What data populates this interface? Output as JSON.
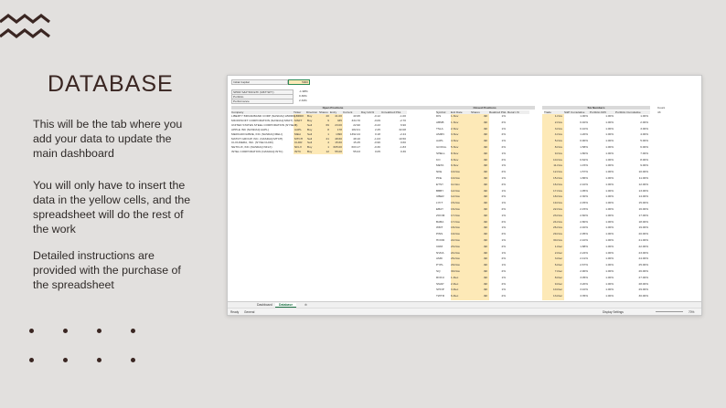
{
  "colors": {
    "background": "#e2e0de",
    "accent": "#3a2622",
    "input_cells": "#fde9b7"
  },
  "icons": {
    "zigzag": "zigzag-decoration-icon",
    "dots": "dot-grid-decoration-icon"
  },
  "heading": "DATABASE",
  "paragraphs": [
    "This will be the tab where you add your data to update the main dashboard",
    "You will only have to insert the data in the yellow cells, and the spreadsheet will do the rest of the work",
    "Detailed instructions are provided with the purchase of the spreadsheet"
  ],
  "sheet": {
    "initial_capital_label": "Initial Capital",
    "initial_capital_value": "5000",
    "benchmark_label": "SPDR S&P 500 ETF (MKT:SPY)",
    "benchmark_value": "-1.98%",
    "portfolio_label": "Portfolio",
    "portfolio_value": "0.36%",
    "performance_label": "Performance",
    "performance_value": "2.34%",
    "open_positions_header": "Open Positions",
    "open_columns": [
      "Company",
      "Ticker",
      "Direction",
      "Shares",
      "Entry",
      "Current",
      "Day G/L%",
      "Unrealized P&L"
    ],
    "open_rows": [
      [
        "LIBERTY BROADBAND CORP (NASDAQ:LBRDK)",
        "LBRDK",
        "Buy",
        "20",
        "41.00",
        "40.95",
        "-0.12",
        "-1.00"
      ],
      [
        "MICROSOFT CORPORATION (NASDAQ:MSFT)",
        "MSFT",
        "Buy",
        "9",
        "335",
        "334.70",
        "-0.09",
        "-2.70"
      ],
      [
        "UNITED STATES STEEL CORPORATION (NYSE:X)",
        "X",
        "Sell",
        "69",
        "23.00",
        "22.90",
        "-0.43",
        "6.90"
      ],
      [
        "APPLE INC (NASDAQ:AAPL)",
        "AAPL",
        "Buy",
        "8",
        "178",
        "182.01",
        "2.25",
        "32.08"
      ],
      [
        "MERCADOLIBRE, INC (NASDAQ:MELI)",
        "MELI",
        "Sell",
        "1",
        "1390",
        "1392.44",
        "0.18",
        "-2.44"
      ],
      [
        "MATCH GROUP, INC. (NASDAQ:MTCH)",
        "MTCH",
        "Sell",
        "21",
        "48.60",
        "48.10",
        "-1.03",
        "10.50"
      ],
      [
        "CLOUDERA, INC. (NYSE:CLDR)",
        "CLDR",
        "Sell",
        "4",
        "15.60",
        "15.45",
        "-0.96",
        "0.60"
      ],
      [
        "NETFLIX, INC (NASDAQ:NFLX)",
        "NFLX",
        "Buy",
        "1",
        "605.00",
        "603.17",
        "-0.30",
        "-1.83"
      ],
      [
        "INTEL CORPORATION (NASDAQ:INTC)",
        "INTC",
        "Buy",
        "12",
        "55.00",
        "55.03",
        "0.05",
        "0.36"
      ]
    ],
    "closed_positions_header": "Closed Positions",
    "closed_columns": [
      "Symbol",
      "Exit Date",
      "Shares",
      "Realized P&L",
      "Return %"
    ],
    "closed_rows": [
      [
        "DIS",
        "1-Nov",
        "-$0",
        "1%"
      ],
      [
        "ABNB",
        "1-Nov",
        "-$0",
        "2%"
      ],
      [
        "TSLA",
        "2-Nov",
        "-$0",
        "1%"
      ],
      [
        "AMZN",
        "3-Nov",
        "-$0",
        "2%"
      ],
      [
        "AAPL",
        "4-Nov",
        "-$0",
        "1%"
      ],
      [
        "GOOGL",
        "5-Nov",
        "-$0",
        "2%"
      ],
      [
        "SHELL",
        "8-Nov",
        "-$0",
        "1%"
      ],
      [
        "KO",
        "9-Nov",
        "-$0",
        "2%"
      ],
      [
        "META",
        "9-Nov",
        "-$0",
        "1%"
      ],
      [
        "NKE",
        "10-Nov",
        "-$0",
        "2%"
      ],
      [
        "PFE",
        "10-Nov",
        "-$0",
        "1%"
      ],
      [
        "ETSY",
        "11-Nov",
        "-$0",
        "2%"
      ],
      [
        "BBBY",
        "12-Nov",
        "-$0",
        "1%"
      ],
      [
        "UBER",
        "12-Nov",
        "-$0",
        "2%"
      ],
      [
        "LYFT",
        "15-Nov",
        "-$0",
        "1%"
      ],
      [
        "EBAY",
        "16-Nov",
        "-$0",
        "2%"
      ],
      [
        "ZOOM",
        "17-Nov",
        "-$0",
        "1%"
      ],
      [
        "BABA",
        "17-Nov",
        "-$0",
        "2%"
      ],
      [
        "WMT",
        "18-Nov",
        "-$0",
        "1%"
      ],
      [
        "PINS",
        "19-Nov",
        "-$0",
        "2%"
      ],
      [
        "HOOD",
        "22-Nov",
        "-$0",
        "1%"
      ],
      [
        "CRM",
        "23-Nov",
        "-$0",
        "2%"
      ],
      [
        "NVDA",
        "24-Nov",
        "-$0",
        "1%"
      ],
      [
        "AMD",
        "26-Nov",
        "-$0",
        "2%"
      ],
      [
        "PYPL",
        "29-Nov",
        "-$0",
        "1%"
      ],
      [
        "SQ",
        "30-Nov",
        "-$0",
        "2%"
      ],
      [
        "ROKU",
        "1-Dec",
        "-$0",
        "1%"
      ],
      [
        "SNAP",
        "2-Dec",
        "-$0",
        "2%"
      ],
      [
        "SHOP",
        "3-Dec",
        "-$0",
        "1%"
      ],
      [
        "TWTR",
        "6-Dec",
        "-$0",
        "2%"
      ]
    ],
    "six_numbers_header": "Six Numbers",
    "six_columns": [
      "Trade",
      "S&P Cumulative",
      "Portfolio Drift",
      "Portfolio Cumulative"
    ],
    "six_rows": [
      [
        "1-Nov",
        "1.00%",
        "1.00%",
        "1.00%"
      ],
      [
        "2-Nov",
        "0.40%",
        "1.00%",
        "2.00%"
      ],
      [
        "3-Nov",
        "0.10%",
        "1.00%",
        "3.00%"
      ],
      [
        "4-Nov",
        "1.20%",
        "1.00%",
        "4.00%"
      ],
      [
        "5-Nov",
        "0.90%",
        "1.00%",
        "5.00%"
      ],
      [
        "8-Nov",
        "1.58%",
        "1.00%",
        "6.00%"
      ],
      [
        "9-Nov",
        "1.80%",
        "1.00%",
        "7.00%"
      ],
      [
        "10-Nov",
        "0.62%",
        "1.00%",
        "8.00%"
      ],
      [
        "11-Nov",
        "1.15%",
        "1.00%",
        "9.00%"
      ],
      [
        "12-Nov",
        "1.57%",
        "1.00%",
        "10.00%"
      ],
      [
        "15-Nov",
        "1.86%",
        "1.00%",
        "11.00%"
      ],
      [
        "16-Nov",
        "2.10%",
        "1.00%",
        "12.00%"
      ],
      [
        "17-Nov",
        "1.95%",
        "1.00%",
        "13.00%"
      ],
      [
        "18-Nov",
        "2.30%",
        "1.00%",
        "14.00%"
      ],
      [
        "19-Nov",
        "2.45%",
        "1.00%",
        "15.00%"
      ],
      [
        "22-Nov",
        "2.15%",
        "1.00%",
        "16.00%"
      ],
      [
        "23-Nov",
        "2.60%",
        "1.00%",
        "17.00%"
      ],
      [
        "24-Nov",
        "2.80%",
        "1.00%",
        "18.00%"
      ],
      [
        "26-Nov",
        "2.40%",
        "1.00%",
        "19.00%"
      ],
      [
        "29-Nov",
        "2.95%",
        "1.00%",
        "20.00%"
      ],
      [
        "30-Nov",
        "2.10%",
        "1.00%",
        "21.00%"
      ],
      [
        "1-Dec",
        "1.88%",
        "1.00%",
        "22.00%"
      ],
      [
        "2-Dec",
        "2.22%",
        "1.00%",
        "23.00%"
      ],
      [
        "3-Dec",
        "2.41%",
        "1.00%",
        "24.00%"
      ],
      [
        "6-Dec",
        "2.67%",
        "1.00%",
        "25.00%"
      ],
      [
        "7-Dec",
        "2.90%",
        "1.00%",
        "26.00%"
      ],
      [
        "8-Dec",
        "3.05%",
        "1.00%",
        "27.00%"
      ],
      [
        "9-Dec",
        "3.20%",
        "1.00%",
        "28.00%"
      ],
      [
        "10-Dec",
        "3.10%",
        "1.00%",
        "29.00%"
      ],
      [
        "13-Dec",
        "3.35%",
        "1.00%",
        "30.00%"
      ]
    ],
    "count_label": "Count",
    "count_value": "43",
    "tabs": [
      "Dashboard",
      "Database"
    ],
    "status_ready": "Ready",
    "status_general": "General",
    "display_settings": "Display Settings",
    "zoom": "70%"
  }
}
